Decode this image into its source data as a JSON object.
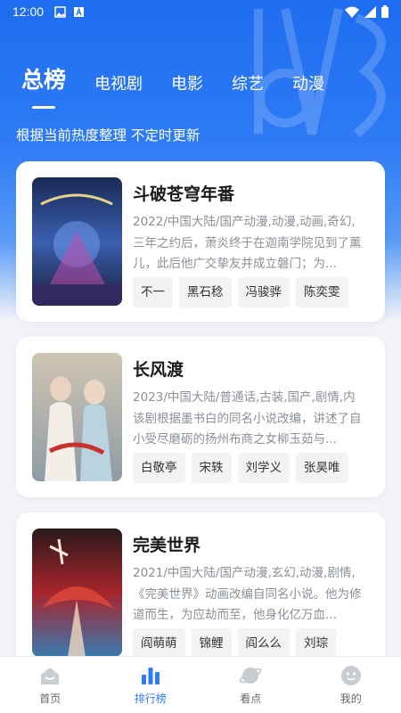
{
  "status_bar": {
    "time": "12:00"
  },
  "tabs": [
    {
      "label": "总榜",
      "active": true
    },
    {
      "label": "电视剧",
      "active": false
    },
    {
      "label": "电影",
      "active": false
    },
    {
      "label": "综艺",
      "active": false
    },
    {
      "label": "动漫",
      "active": false
    }
  ],
  "subtitle": "根据当前热度整理 不定时更新",
  "items": [
    {
      "title": "斗破苍穹年番",
      "meta": "2022/中国大陆/国产动漫,动漫,动画,奇幻,",
      "desc": "三年之约后，萧炎终于在迦南学院见到了薰儿，此后他广交挚友并成立磐门；为...",
      "tags": [
        "不一",
        "黑石稔",
        "冯骏骅",
        "陈奕雯"
      ]
    },
    {
      "title": "长风渡",
      "meta": "2023/中国大陆/普通话,古装,国产,剧情,内",
      "desc": "该剧根据墨书白的同名小说改编，讲述了自小受尽磨砺的扬州布商之女柳玉茹与...",
      "tags": [
        "白敬亭",
        "宋轶",
        "刘学义",
        "张昊唯"
      ]
    },
    {
      "title": "完美世界",
      "meta": "2021/中国大陆/国产动漫,玄幻,动漫,剧情,",
      "desc": "《完美世界》动画改编自同名小说。他为修道而生，为应劫而至，他身化亿万血...",
      "tags": [
        "阎萌萌",
        "锦鲤",
        "阎么么",
        "刘琮"
      ]
    }
  ],
  "bottom_nav": [
    {
      "label": "首页",
      "icon": "home-icon",
      "active": false
    },
    {
      "label": "排行榜",
      "icon": "ranking-icon",
      "active": true
    },
    {
      "label": "看点",
      "icon": "planet-icon",
      "active": false
    },
    {
      "label": "我的",
      "icon": "profile-icon",
      "active": false
    }
  ],
  "colors": {
    "accent": "#2f7cf6",
    "hero": "#1f6df0"
  }
}
